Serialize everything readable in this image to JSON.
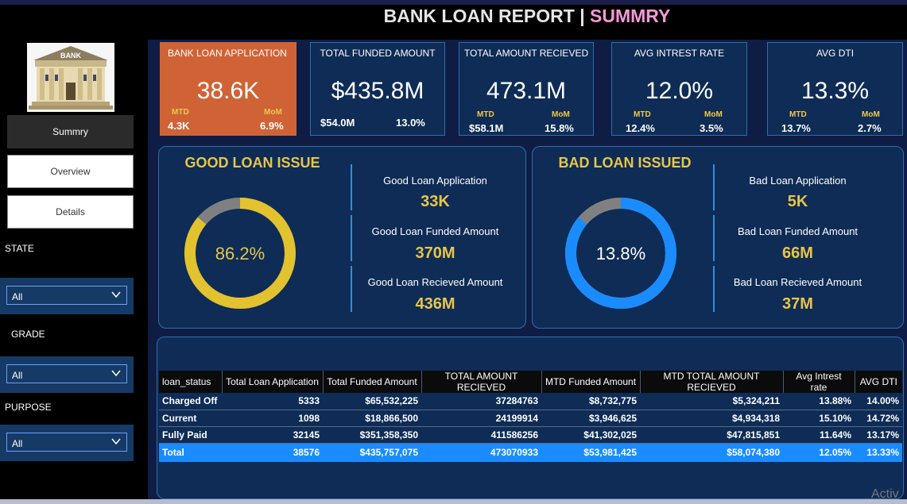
{
  "header": {
    "title_main": "BANK LOAN REPORT | ",
    "title_accent": "SUMMRY",
    "accent_color": "#f49ad6"
  },
  "sidebar": {
    "logo_text": "BANK",
    "nav": [
      {
        "label": "Summry"
      },
      {
        "label": "Overview"
      },
      {
        "label": "Details"
      }
    ],
    "filters": [
      {
        "label": "STATE",
        "value": "All"
      },
      {
        "label": "GRADE",
        "value": "All"
      },
      {
        "label": "PURPOSE",
        "value": "All"
      }
    ]
  },
  "kpis": [
    {
      "label": "BANK LOAN APPLICATION",
      "value": "38.6K",
      "mtd_label": "MTD",
      "mtd": "4.3K",
      "mom_label": "MoM",
      "mom": "6.9%"
    },
    {
      "label": "TOTAL FUNDED AMOUNT",
      "value": "$435.8M",
      "mtd": "$54.0M",
      "mom": "13.0%"
    },
    {
      "label": "TOTAL AMOUNT RECIEVED",
      "value": "473.1M",
      "mtd_label": "MTD",
      "mtd": "$58.1M",
      "mom_label": "MoM",
      "mom": "15.8%"
    },
    {
      "label": "AVG INTREST RATE",
      "value": "12.0%",
      "mtd_label": "MTD",
      "mtd": "12.4%",
      "mom_label": "MoM",
      "mom": "3.5%"
    },
    {
      "label": "AVG DTI",
      "value": "13.3%",
      "mtd_label": "MTD",
      "mtd": "13.7%",
      "mom_label": "MoM",
      "mom": "2.7%"
    }
  ],
  "good_loan": {
    "title": "GOOD LOAN ISSUE",
    "percent": "86.2%",
    "fraction": 0.862,
    "color": "#e2c22f",
    "metrics": [
      {
        "label": "Good Loan Application",
        "value": "33K"
      },
      {
        "label": "Good Loan Funded Amount",
        "value": "370M"
      },
      {
        "label": "Good Loan Recieved Amount",
        "value": "436M"
      }
    ]
  },
  "bad_loan": {
    "title": "BAD LOAN ISSUED",
    "percent": "13.8%",
    "fraction": 0.862,
    "color": "#1a8cff",
    "metrics": [
      {
        "label": "Bad Loan Application",
        "value": "5K"
      },
      {
        "label": "Bad Loan Funded Amount",
        "value": "66M"
      },
      {
        "label": "Bad Loan Recieved Amount",
        "value": "37M"
      }
    ]
  },
  "table": {
    "headers": [
      "loan_status",
      "Total Loan Application",
      "Total Funded Amount",
      "TOTAL AMOUNT RECIEVED",
      "MTD Funded Amount",
      "MTD TOTAL AMOUNT RECIEVED",
      "Avg Intrest rate",
      "AVG DTI"
    ],
    "rows": [
      [
        "Charged Off",
        "5333",
        "$65,532,225",
        "37284763",
        "$8,732,775",
        "$5,324,211",
        "13.88%",
        "14.00%"
      ],
      [
        "Current",
        "1098",
        "$18,866,500",
        "24199914",
        "$3,946,625",
        "$4,934,318",
        "15.10%",
        "14.72%"
      ],
      [
        "Fully Paid",
        "32145",
        "$351,358,350",
        "411586256",
        "$41,302,025",
        "$47,815,851",
        "11.64%",
        "13.17%"
      ]
    ],
    "total": [
      "Total",
      "38576",
      "$435,757,075",
      "473070933",
      "$53,981,425",
      "$58,074,380",
      "12.05%",
      "13.33%"
    ]
  },
  "watermark": "Activ"
}
